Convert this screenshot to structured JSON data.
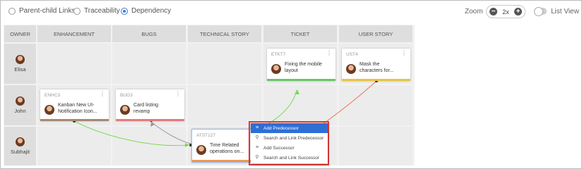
{
  "view_options": [
    {
      "label": "Parent-child Links",
      "selected": false
    },
    {
      "label": "Traceability",
      "selected": false
    },
    {
      "label": "Dependency",
      "selected": true
    }
  ],
  "zoom": {
    "label": "Zoom",
    "value": "2x"
  },
  "list_view": {
    "label": "List View",
    "enabled": false
  },
  "board": {
    "owner_header": "OWNER",
    "columns": [
      "ENHANCEMENT",
      "BUGS",
      "TECHNICAL STORY",
      "TICKET",
      "USER STORY"
    ],
    "owners": [
      "Elisa",
      "John",
      "Subhajit"
    ]
  },
  "cards": [
    {
      "id": "ETKT7",
      "title_l1": "Fixing the mobile",
      "title_l2": "layout",
      "bar_color": "#6cc56c"
    },
    {
      "id": "UST4",
      "title_l1": "Mask the",
      "title_l2": "characters for...",
      "bar_color": "#e7c443"
    },
    {
      "id": "ENHC3",
      "title_l1": "Kanban New UI-",
      "title_l2": "Notification Icon...",
      "bar_color": "#a68972"
    },
    {
      "id": "BUG3",
      "title_l1": "Card listing",
      "title_l2": "revamp",
      "bar_color": "#e47b7b"
    },
    {
      "id": "ATST127",
      "title_l1": "Time Related",
      "title_l2": "operations on...",
      "bar_color": "#e99a55"
    }
  ],
  "context_menu": {
    "items": [
      {
        "label": "Add Predecessor",
        "icon": "list-icon",
        "active": true
      },
      {
        "label": "Search and Link Predecessor",
        "icon": "search-icon",
        "active": false
      },
      {
        "label": "Add Successor",
        "icon": "list-icon",
        "active": false
      },
      {
        "label": "Search and Link Successor",
        "icon": "search-icon",
        "active": false
      }
    ]
  },
  "colors": {
    "link_green": "#7ed957",
    "link_red": "#ef6f5a",
    "link_gray": "#9a9a9a",
    "accent": "#2e6fd6",
    "highlight_frame": "#e03a3a"
  }
}
